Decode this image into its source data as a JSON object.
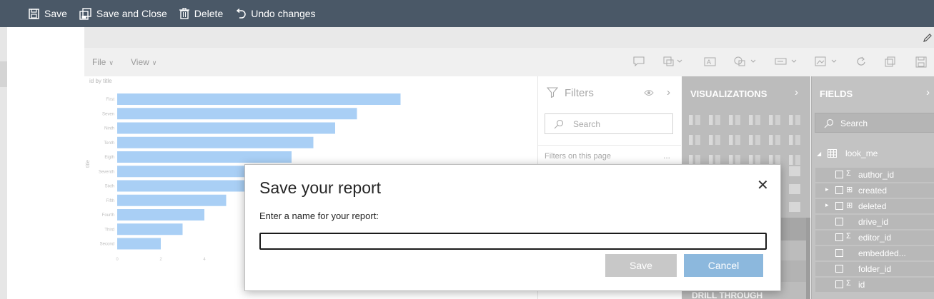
{
  "toolbar": {
    "save": "Save",
    "save_close": "Save and Close",
    "delete": "Delete",
    "undo": "Undo changes"
  },
  "menubar": {
    "file": "File",
    "view": "View"
  },
  "chart_data": {
    "type": "bar",
    "orientation": "horizontal",
    "title": "id by title",
    "ylabel": "title",
    "categories": [
      "First",
      "Seven",
      "Ninth",
      "Tenth",
      "Eigth",
      "Seventh",
      "Sixth",
      "Fifth",
      "Fourth",
      "Third",
      "Second"
    ],
    "values": [
      13,
      11,
      10,
      9,
      8,
      7,
      6,
      5,
      4,
      3,
      2
    ],
    "xlim": [
      0,
      16
    ],
    "xticks": [
      "0",
      "2",
      "4"
    ],
    "bar_color": "#a9cff5"
  },
  "filters": {
    "title": "Filters",
    "search_placeholder": "Search",
    "page_section": "Filters on this page",
    "more": "..."
  },
  "visualizations": {
    "title": "VISUALIZATIONS",
    "drill": "DRILL THROUGH"
  },
  "fields": {
    "title": "FIELDS",
    "search_placeholder": "Search",
    "table": "look_me",
    "items": [
      {
        "label": "author_id",
        "type": "sigma",
        "expandable": false
      },
      {
        "label": "created",
        "type": "table",
        "expandable": true
      },
      {
        "label": "deleted",
        "type": "table",
        "expandable": true
      },
      {
        "label": "drive_id",
        "type": "none",
        "expandable": false
      },
      {
        "label": "editor_id",
        "type": "sigma",
        "expandable": false
      },
      {
        "label": "embedded...",
        "type": "none",
        "expandable": false
      },
      {
        "label": "folder_id",
        "type": "none",
        "expandable": false
      },
      {
        "label": "id",
        "type": "sigma",
        "expandable": false
      }
    ]
  },
  "dialog": {
    "title": "Save your report",
    "label": "Enter a name for your report:",
    "input_value": "",
    "save": "Save",
    "cancel": "Cancel"
  }
}
